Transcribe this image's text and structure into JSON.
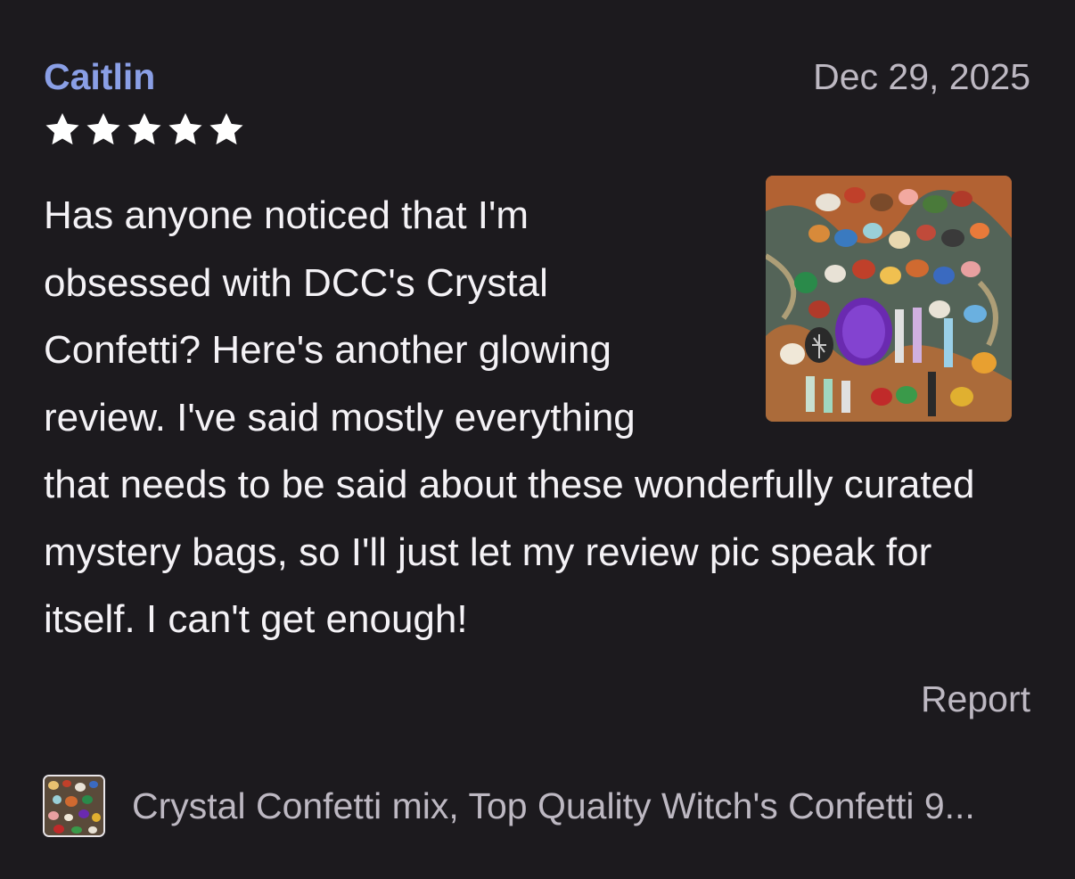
{
  "review": {
    "reviewer_name": "Caitlin",
    "date": "Dec 29, 2025",
    "rating": 5,
    "rating_max": 5,
    "text": "Has anyone noticed that I'm obsessed with DCC's Crystal Confetti? Here's another glowing review. I've said mostly everything that needs to be said about these wonderfully curated mystery bags, so I'll just let my review pic speak for itself. I can't get enough!",
    "report_label": "Report"
  },
  "product": {
    "title": "Crystal Confetti mix, Top Quality Witch's Confetti 9..."
  },
  "colors": {
    "background": "#1c1a1e",
    "reviewer_name": "#8a9fe6",
    "secondary_text": "#bdb8c2",
    "primary_text": "#f4f2f6",
    "star": "#ffffff"
  },
  "icons": {
    "star": "star-icon",
    "review_photo": "review-photo-crystals",
    "product_thumbnail": "product-thumbnail-crystals"
  }
}
